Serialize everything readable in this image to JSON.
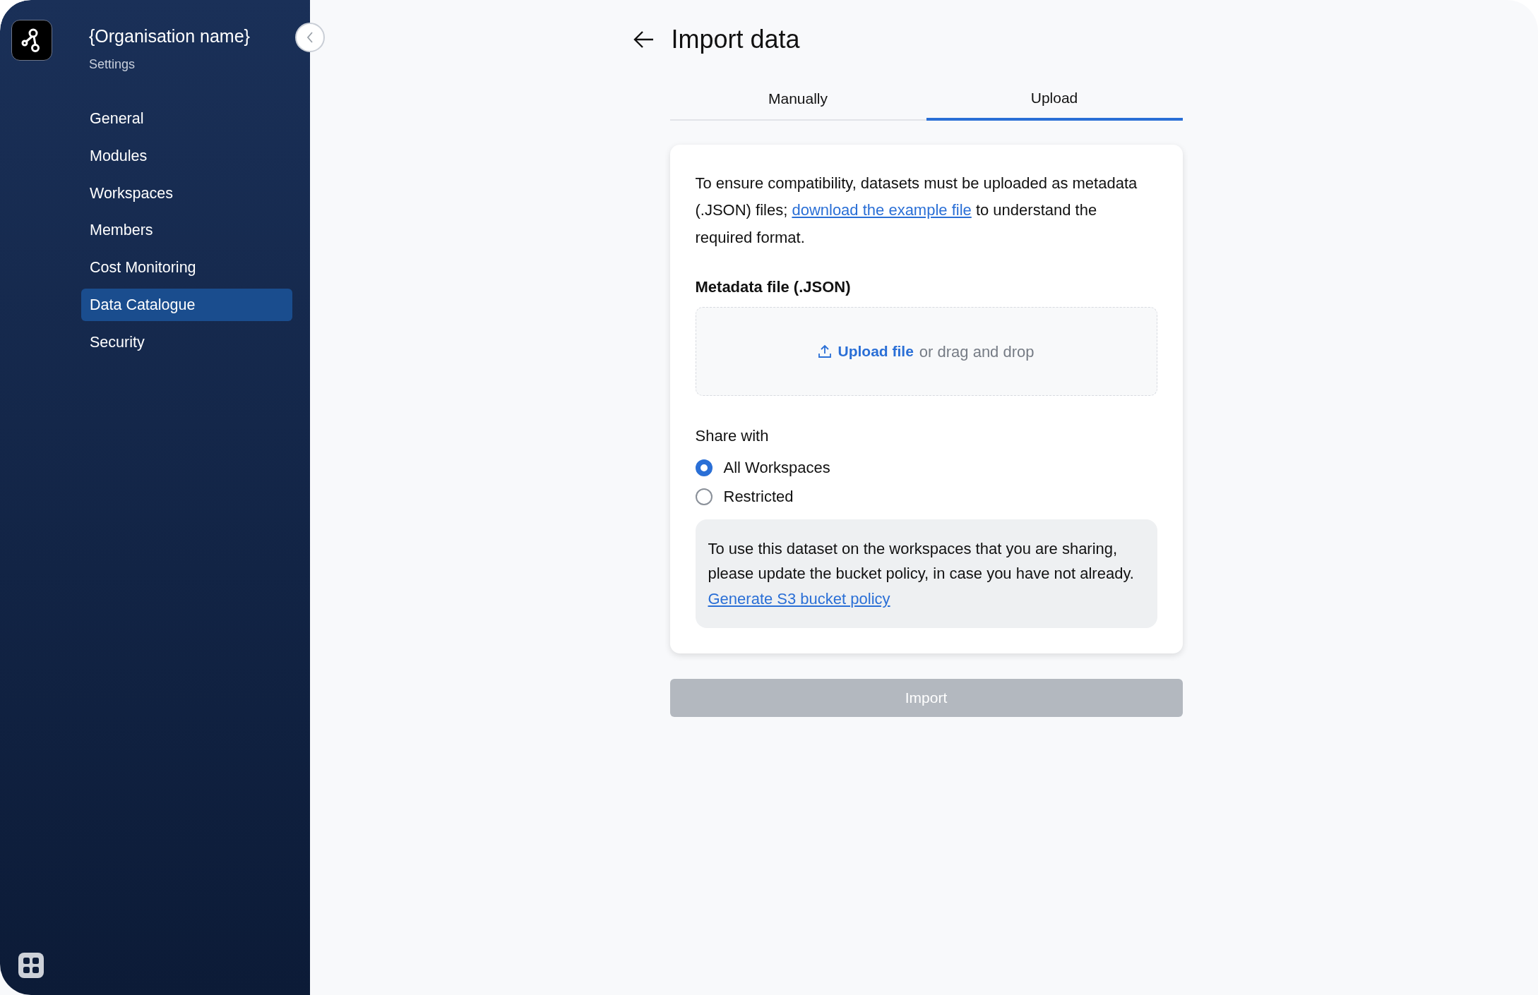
{
  "sidebar": {
    "org_name": "{Organisation name}",
    "subtitle": "Settings",
    "items": [
      {
        "label": "General",
        "selected": false
      },
      {
        "label": "Modules",
        "selected": false
      },
      {
        "label": "Workspaces",
        "selected": false
      },
      {
        "label": "Members",
        "selected": false
      },
      {
        "label": "Cost Monitoring",
        "selected": false
      },
      {
        "label": "Data Catalogue",
        "selected": true
      },
      {
        "label": "Security",
        "selected": false
      }
    ]
  },
  "page": {
    "title": "Import data"
  },
  "tabs": [
    {
      "label": "Manually",
      "selected": false
    },
    {
      "label": "Upload",
      "selected": true
    }
  ],
  "intro": {
    "text_before": "To ensure compatibility, datasets must be uploaded as metadata (.JSON) files;",
    "link": "download the example file",
    "text_after": "to understand the required format."
  },
  "file_field": {
    "label": "Metadata file (.JSON)",
    "upload_link": "Upload file",
    "hint": "or drag and drop"
  },
  "share": {
    "label": "Share with",
    "options": [
      {
        "label": "All Workspaces",
        "selected": true
      },
      {
        "label": "Restricted",
        "selected": false
      }
    ]
  },
  "notice": {
    "text": "To use this dataset on the workspaces that you are sharing, please update the bucket policy, in case you have not already.",
    "link": "Generate S3 bucket policy"
  },
  "import_button": {
    "label": "Import",
    "disabled": true
  }
}
